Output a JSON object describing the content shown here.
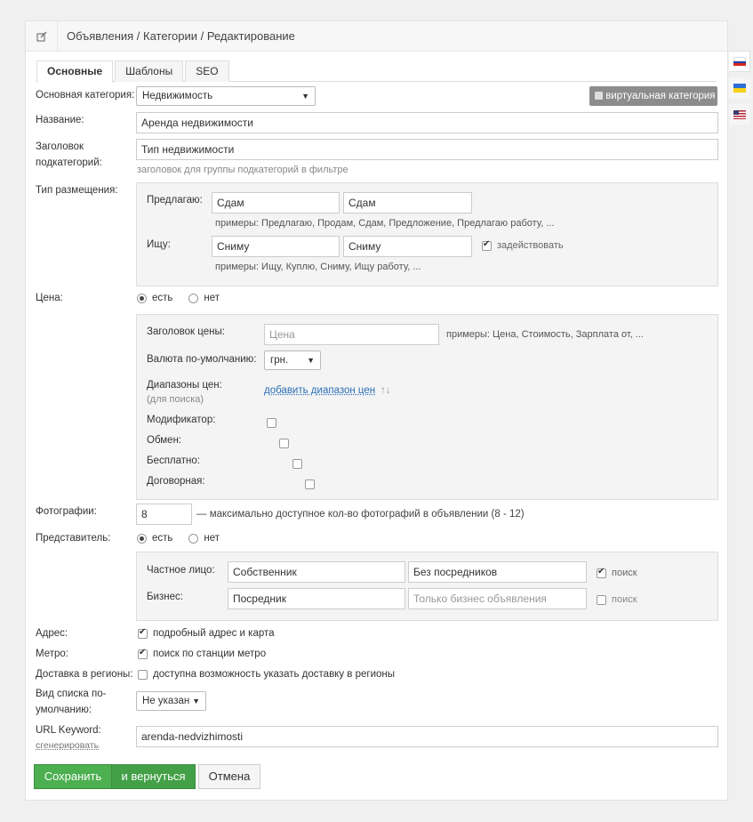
{
  "header": {
    "breadcrumb": "Объявления / Категории / Редактирование"
  },
  "tabs": [
    {
      "label": "Основные",
      "active": true
    },
    {
      "label": "Шаблоны",
      "active": false
    },
    {
      "label": "SEO",
      "active": false
    }
  ],
  "languages": [
    {
      "name": "ru-flag-icon",
      "colors": [
        "#ffffff",
        "#1c3fa8",
        "#d52b1e"
      ]
    },
    {
      "name": "ua-flag-icon",
      "colors": [
        "#2d6fd6",
        "#f7d117"
      ]
    },
    {
      "name": "us-flag-icon",
      "colors": [
        "#b22234",
        "#ffffff",
        "#3c3b6e"
      ]
    }
  ],
  "form": {
    "main_category": {
      "label": "Основная категория:",
      "value": "Недвижимость"
    },
    "virtual_category_label": "виртуальная категория",
    "title": {
      "label": "Название:",
      "value": "Аренда недвижимости"
    },
    "subcat_title": {
      "label": "Заголовок подкатегорий:",
      "value": "Тип недвижимости",
      "hint": "заголовок для группы подкатегорий в фильтре"
    },
    "placement": {
      "label": "Тип размещения:",
      "offer_label": "Предлагаю:",
      "offer_values": [
        "Сдам",
        "Сдам"
      ],
      "offer_examples": "примеры: Предлагаю, Продам, Сдам, Предложение, Предлагаю работу, ...",
      "seek_label": "Ищу:",
      "seek_values": [
        "Сниму",
        "Сниму"
      ],
      "seek_enable": "задействовать",
      "seek_examples": "примеры: Ищу, Куплю, Сниму, Ищу работу, ..."
    },
    "price": {
      "label": "Цена:",
      "yes": "есть",
      "no": "нет",
      "title_label": "Заголовок цены:",
      "title_placeholder": "Цена",
      "title_examples": "примеры: Цена, Стоимость, Зарплата от, ...",
      "currency_label": "Валюта по-умолчанию:",
      "currency_value": "грн.",
      "ranges_label": "Диапазоны цен:",
      "ranges_sub": "(для поиска)",
      "ranges_link": "добавить диапазон цен",
      "ranges_sort": "↑↓",
      "flags": [
        "Модификатор:",
        "Обмен:",
        "Бесплатно:",
        "Договорная:"
      ]
    },
    "photos": {
      "label": "Фотографии:",
      "value": "8",
      "hint": "— максимально доступное кол-во фотографий в объявлении (8 - 12)"
    },
    "representative": {
      "label": "Представитель:",
      "yes": "есть",
      "no": "нет",
      "private_label": "Частное лицо:",
      "private_values": [
        "Собственник",
        "Без посредников"
      ],
      "business_label": "Бизнес:",
      "business_value": "Посредник",
      "business_placeholder": "Только бизнес объявления",
      "search_label": "поиск"
    },
    "address": {
      "label": "Адрес:",
      "option": "подробный адрес и карта"
    },
    "metro": {
      "label": "Метро:",
      "option": "поиск по станции метро"
    },
    "delivery": {
      "label": "Доставка в регионы:",
      "option": "доступна возможность указать доставку в регионы"
    },
    "list_view": {
      "label": "Вид списка по-умолчанию:",
      "value": "Не указан"
    },
    "url_keyword": {
      "label": "URL Keyword:",
      "generate": "сгенерировать",
      "value": "arenda-nedvizhimosti"
    }
  },
  "buttons": {
    "save": "Сохранить",
    "save_return": "и вернуться",
    "cancel": "Отмена"
  }
}
